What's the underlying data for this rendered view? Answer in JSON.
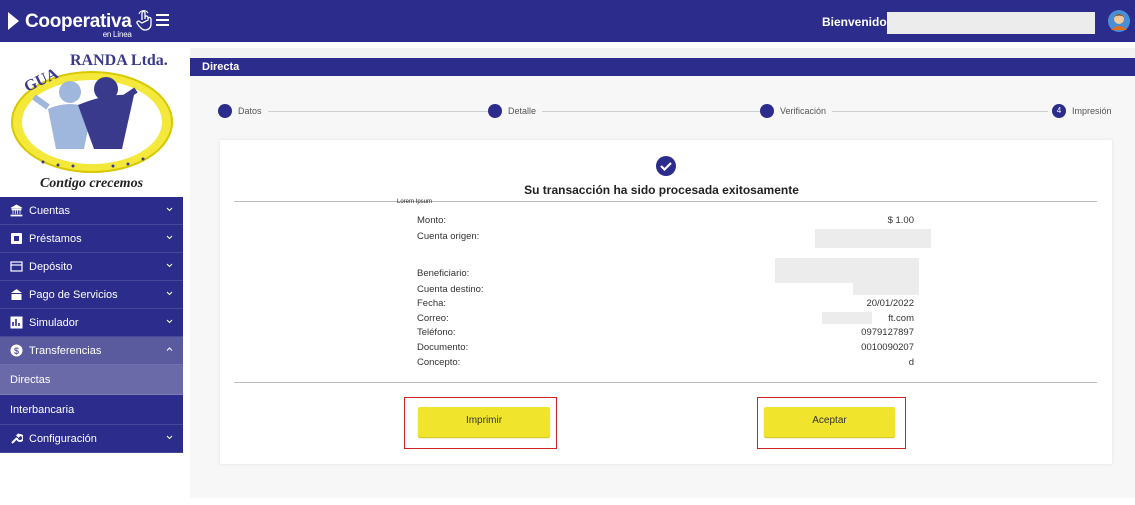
{
  "topbar": {
    "brand_name": "Cooperativa",
    "brand_sub": "en Línea",
    "welcome_label": "Bienvenido Usuario:",
    "username": ""
  },
  "sidebar": {
    "logo_text": "GUARANDA Ltda.",
    "logo_caption": "Contigo crecemos",
    "items": [
      {
        "label": "Cuentas",
        "icon": "bank-icon"
      },
      {
        "label": "Préstamos",
        "icon": "loan-icon"
      },
      {
        "label": "Depósito",
        "icon": "deposit-icon"
      },
      {
        "label": "Pago de Servicios",
        "icon": "services-icon"
      },
      {
        "label": "Simulador",
        "icon": "chart-icon"
      },
      {
        "label": "Transferencias",
        "icon": "transfer-icon"
      }
    ],
    "sub_items": [
      {
        "label": "Directas"
      },
      {
        "label": "Interbancaria"
      }
    ],
    "config": {
      "label": "Configuración",
      "icon": "wrench-icon"
    }
  },
  "section": {
    "title": "Directa"
  },
  "steps": [
    {
      "label": "Datos",
      "num": ""
    },
    {
      "label": "Detalle",
      "num": ""
    },
    {
      "label": "Verificación",
      "num": ""
    },
    {
      "label": "Impresión",
      "num": "4"
    }
  ],
  "receipt": {
    "title": "Su transacción ha sido procesada exitosamente",
    "lorem": "Lorem Ipsum",
    "monto_label": "Monto:",
    "monto_value": "$ 1.00",
    "cuenta_origen_label": "Cuenta origen:",
    "beneficiario_label": "Beneficiario:",
    "cuenta_destino_label": "Cuenta destino:",
    "fecha_label": "Fecha:",
    "fecha_value": "20/01/2022",
    "correo_label": "Correo:",
    "correo_value": "ft.com",
    "telefono_label": "Teléfono:",
    "telefono_value": "0979127897",
    "documento_label": "Documento:",
    "documento_value": "0010090207",
    "concepto_label": "Concepto:",
    "concepto_value": "d"
  },
  "buttons": {
    "print": "Imprimir",
    "accept": "Aceptar"
  },
  "colors": {
    "primary": "#2c2c8c",
    "button": "#f0e52c",
    "highlight": "#cc2222"
  }
}
